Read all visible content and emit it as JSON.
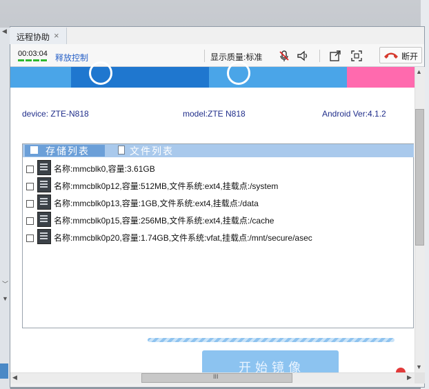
{
  "tab": {
    "title": "远程协助",
    "close": "×"
  },
  "toolbar": {
    "timer": "00:03:04",
    "release_control": "释放控制",
    "quality": "显示质量:标准",
    "hangup": "断开"
  },
  "device_info": {
    "device": "device: ZTE-N818",
    "model": "model:ZTE N818",
    "android": "Android Ver:4.1.2"
  },
  "list_tabs": {
    "storage": "存储列表",
    "files": "文件列表"
  },
  "storage_rows": [
    {
      "text": "名称:mmcblk0,容量:3.61GB"
    },
    {
      "text": "名称:mmcblk0p12,容量:512MB,文件系统:ext4,挂载点:/system"
    },
    {
      "text": "名称:mmcblk0p13,容量:1GB,文件系统:ext4,挂载点:/data"
    },
    {
      "text": "名称:mmcblk0p15,容量:256MB,文件系统:ext4,挂载点:/cache"
    },
    {
      "text": "名称:mmcblk0p20,容量:1.74GB,文件系统:vfat,挂载点:/mnt/secure/asec"
    }
  ],
  "start_button": "开始镜像",
  "scroll": {
    "up": "▲",
    "down": "▼",
    "left": "◀",
    "right": "▶",
    "grip": "III"
  },
  "colors": {
    "accent": "#2a62c7",
    "banner_dark": "#1f77cf",
    "banner_light": "#4aa5e8",
    "banner_pink": "#ff6aae",
    "start": "#8cc3f0"
  },
  "icons": [
    "mic-muted-icon",
    "speaker-icon",
    "popout-icon",
    "fullscreen-icon",
    "hangup-phone-icon",
    "disk-icon",
    "file-icon"
  ]
}
